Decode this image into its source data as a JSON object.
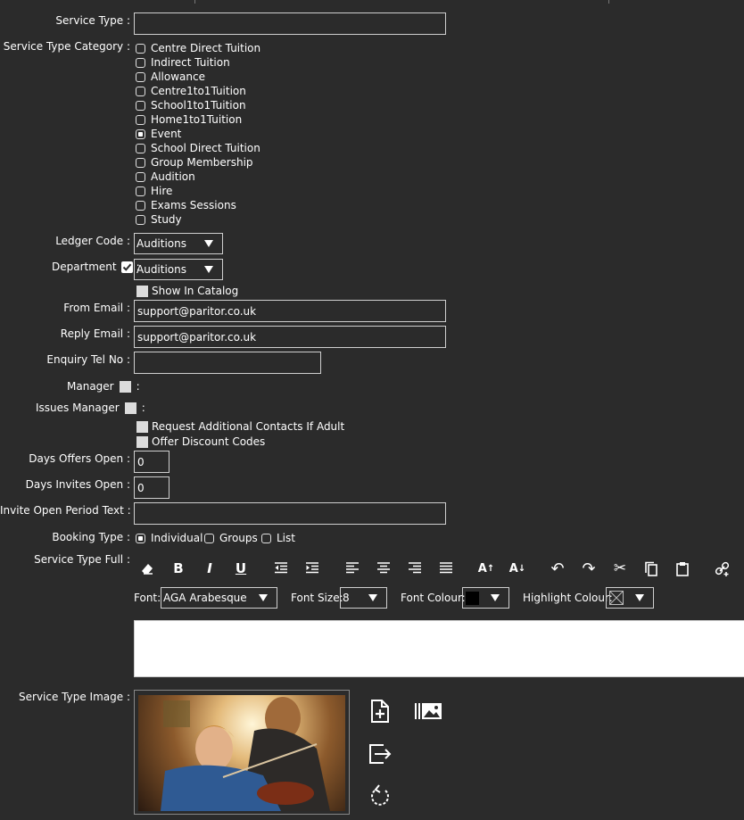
{
  "form": {
    "service_type": {
      "label": "Service Type :",
      "value": ""
    },
    "category": {
      "label": "Service Type Category :",
      "options": [
        {
          "label": "Centre Direct Tuition",
          "checked": false
        },
        {
          "label": "Indirect Tuition",
          "checked": false
        },
        {
          "label": "Allowance",
          "checked": false
        },
        {
          "label": "Centre1to1Tuition",
          "checked": false
        },
        {
          "label": "School1to1Tuition",
          "checked": false
        },
        {
          "label": "Home1to1Tuition",
          "checked": false
        },
        {
          "label": "Event",
          "checked": true
        },
        {
          "label": "School Direct Tuition",
          "checked": false
        },
        {
          "label": "Group Membership",
          "checked": false
        },
        {
          "label": "Audition",
          "checked": false
        },
        {
          "label": "Hire",
          "checked": false
        },
        {
          "label": "Exams Sessions",
          "checked": false
        },
        {
          "label": "Study",
          "checked": false
        }
      ]
    },
    "ledger_code": {
      "label": "Ledger Code :",
      "value": "Auditions"
    },
    "department": {
      "label": "Department",
      "colon": ":",
      "value": "Auditions",
      "checked": true
    },
    "show_in_catalog": {
      "label": "Show In Catalog",
      "checked": false
    },
    "from_email": {
      "label": "From Email :",
      "value": "support@paritor.co.uk"
    },
    "reply_email": {
      "label": "Reply Email :",
      "value": "support@paritor.co.uk"
    },
    "enquiry_tel": {
      "label": "Enquiry Tel No :",
      "value": ""
    },
    "manager": {
      "label": "Manager",
      "colon": ":"
    },
    "issues_manager": {
      "label": "Issues Manager",
      "colon": ":"
    },
    "request_contacts": {
      "label": "Request Additional Contacts If Adult",
      "checked": false
    },
    "offer_discount": {
      "label": "Offer Discount Codes",
      "checked": false
    },
    "days_offers_open": {
      "label": "Days Offers Open :",
      "value": "0"
    },
    "days_invites_open": {
      "label": "Days Invites Open :",
      "value": "0"
    },
    "invite_open_period": {
      "label": "Invite Open Period Text :",
      "value": ""
    },
    "booking_type": {
      "label": "Booking Type :",
      "options": [
        {
          "label": "Individual",
          "checked": true
        },
        {
          "label": "Groups",
          "checked": false
        },
        {
          "label": "List",
          "checked": false
        }
      ]
    },
    "service_type_full": {
      "label": "Service Type Full :"
    },
    "font_bar": {
      "font_label": "Font:",
      "font_value": "AGA Arabesque",
      "size_label": "Font Size:",
      "size_value": "8",
      "colour_label": "Font Colour:",
      "colour_value": "#000000",
      "highlight_label": "Highlight Colour:"
    },
    "service_type_image": {
      "label": "Service Type Image :"
    }
  },
  "toolbar_icons": [
    "eraser-icon",
    "bold-icon",
    "italic-icon",
    "underline-icon",
    "outdent-icon",
    "indent-icon",
    "align-left-icon",
    "align-center-icon",
    "align-right-icon",
    "justify-icon",
    "font-increase-icon",
    "font-decrease-icon",
    "undo-icon",
    "redo-icon",
    "cut-icon",
    "copy-icon",
    "paste-icon",
    "link-icon"
  ],
  "image_actions": [
    "add-file-icon",
    "image-library-icon",
    "export-icon",
    "refresh-icon"
  ]
}
